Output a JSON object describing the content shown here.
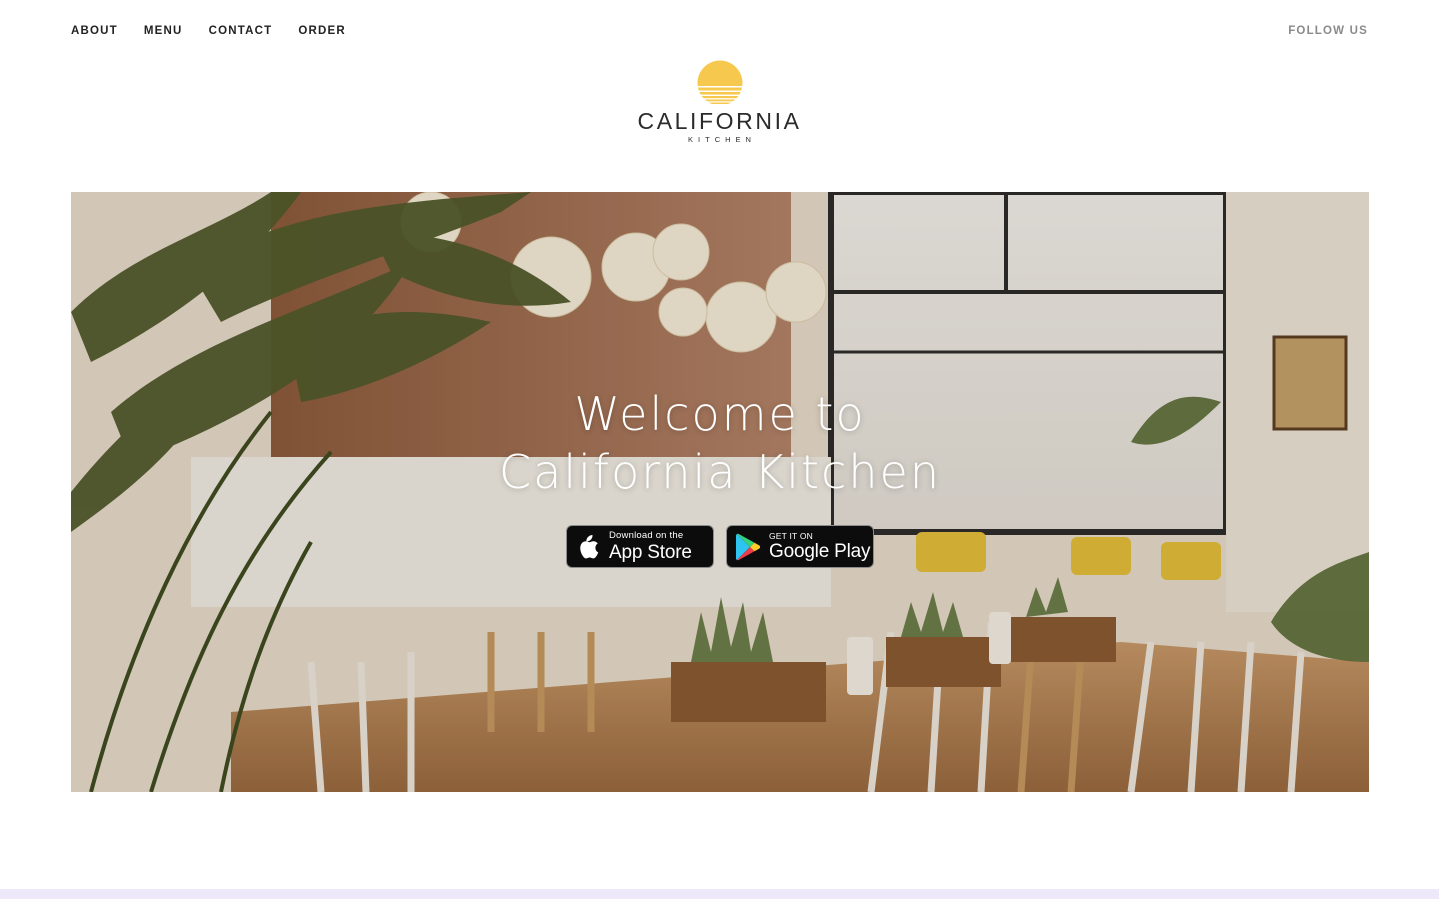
{
  "nav": {
    "items": [
      {
        "label": "ABOUT"
      },
      {
        "label": "MENU"
      },
      {
        "label": "CONTACT"
      },
      {
        "label": "ORDER"
      }
    ],
    "follow_label": "FOLLOW US"
  },
  "logo": {
    "icon": "sun-icon",
    "wordmark": "CALIFORNIA",
    "subtitle": "KITCHEN",
    "sun_color": "#f6c94e"
  },
  "hero": {
    "title_line1": "Welcome to",
    "title_line2": "California Kitchen",
    "badges": {
      "app_store": {
        "icon": "apple-icon",
        "small": "Download on the",
        "big": "App Store"
      },
      "google_play": {
        "icon": "google-play-icon",
        "small": "GET IT ON",
        "big": "Google Play"
      }
    }
  },
  "colors": {
    "text": "#222222",
    "muted": "#8a8a8a",
    "accent": "#f6c94e",
    "footer_bar": "#ede9fb"
  }
}
